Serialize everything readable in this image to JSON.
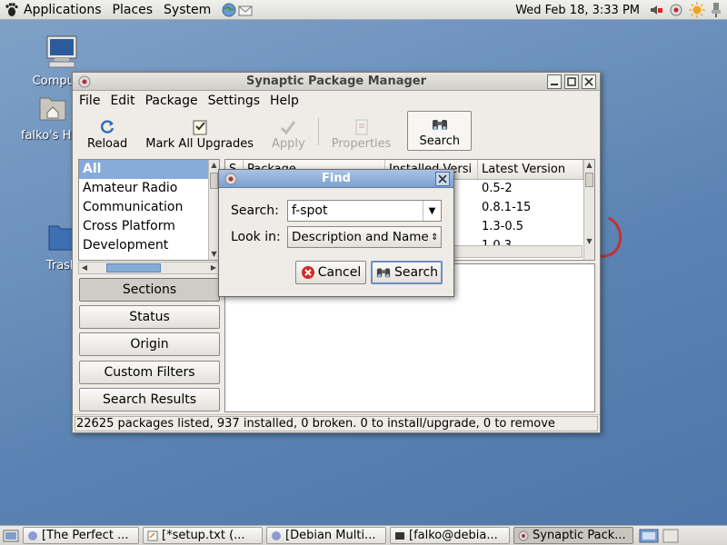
{
  "top_panel": {
    "menus": [
      "Applications",
      "Places",
      "System"
    ],
    "clock": "Wed Feb 18,  3:33 PM"
  },
  "desktop": {
    "icons": [
      {
        "label": "Computer"
      },
      {
        "label": "falko's Home"
      },
      {
        "label": "Trash"
      }
    ]
  },
  "window": {
    "title": "Synaptic Package Manager",
    "menubar": [
      {
        "label": "File"
      },
      {
        "label": "Edit"
      },
      {
        "label": "Package"
      },
      {
        "label": "Settings"
      },
      {
        "label": "Help"
      }
    ],
    "toolbar": {
      "reload": "Reload",
      "mark_all": "Mark All Upgrades",
      "apply": "Apply",
      "properties": "Properties",
      "search": "Search"
    },
    "categories": [
      "All",
      "Amateur Radio",
      "Communication",
      "Cross Platform",
      "Development"
    ],
    "side_buttons": {
      "sections": "Sections",
      "status": "Status",
      "origin": "Origin",
      "custom_filters": "Custom Filters",
      "search_results": "Search Results"
    },
    "package_list": {
      "columns": [
        "S",
        "Package",
        "Installed Versi",
        "Latest Version"
      ],
      "rows": [
        {
          "latest": "0.5-2"
        },
        {
          "latest": "0.8.1-15"
        },
        {
          "latest": "1.3-0.5"
        },
        {
          "latest": "1.0.3"
        }
      ]
    },
    "status": "22625 packages listed, 937 installed, 0 broken. 0 to install/upgrade, 0 to remove"
  },
  "find_dialog": {
    "title": "Find",
    "search_label": "Search:",
    "search_value": "f-spot",
    "lookin_label": "Look in:",
    "lookin_value": "Description and Name",
    "cancel": "Cancel",
    "search_button": "Search"
  },
  "taskbar": {
    "items": [
      {
        "label": "[The Perfect ..."
      },
      {
        "label": "[*setup.txt (..."
      },
      {
        "label": "[Debian Multi..."
      },
      {
        "label": "[falko@debia..."
      },
      {
        "label": "Synaptic Pack..."
      }
    ]
  },
  "colors": {
    "selection": "#86abd9",
    "dialog_title": "#7c9fd0",
    "desktop": "#5a82b2"
  }
}
